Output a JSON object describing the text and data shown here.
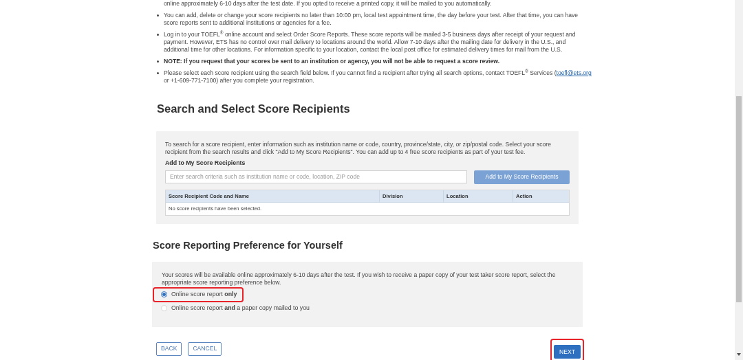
{
  "info_list": [
    {
      "kind": "continuation",
      "text": "online approximately 6-10 days after the test date. If you opted to receive a printed copy, it will be mailed to you automatically."
    },
    {
      "kind": "text",
      "text": "You can add, delete or change your score recipients no later than 10:00 pm, local test appointment time, the day before your test. After that time, you can have score reports sent to additional institutions or agencies for a fee."
    },
    {
      "kind": "text",
      "text": "Log in to your TOEFL$^{®}$ online account and select Order Score Reports. These score reports will be mailed 3-5 business days after receipt of your request and payment. However, ETS has no control over mail delivery to locations around the world. Allow 7-10 days after the mailing date for delivery in the U.S., and additional time for other locations. For information specific to your location, contact the local post office for estimated delivery times for mail from the U.S."
    },
    {
      "kind": "note",
      "text": "NOTE: If you request that your scores be sent to an institution or agency, you will not be able to request a score review."
    },
    {
      "kind": "link_text",
      "before": "Please select each score recipient using the search field below. If you cannot find a recipient after trying all search options, contact TOEFL$^{®}$ Services (",
      "link": "toefl@ets.org",
      "after": " or +1-609-771-7100) after you complete your registration."
    }
  ],
  "recipients": {
    "heading": "Search and Select Score Recipients",
    "intro": "To search for a score recipient, enter information such as institution name or code, country, province/state, city, or zip/postal code. Select your score recipient from the search results and click \"Add to My Score Recipients\". You can add up to 4 free score recipients as part of your test fee.",
    "field_label": "Add to My Score Recipients",
    "search": {
      "placeholder": "Enter search criteria such as institution name or code, location, ZIP code"
    },
    "add_button": "Add to My Score Recipients",
    "table": {
      "columns": [
        "Score Recipient Code and Name",
        "Division",
        "Location",
        "Action"
      ],
      "empty_message": "No score recipients have been selected."
    }
  },
  "preference": {
    "heading": "Score Reporting Preference for Yourself",
    "intro": "Your scores will be available online approximately 6-10 days after the test. If you wish to receive a paper copy of your test taker score report, select the appropriate score reporting preference below.",
    "options": [
      {
        "label": "Online score report **only**",
        "selected": true,
        "highlighted": true
      },
      {
        "label": "Online score report **and** a paper copy mailed to you",
        "selected": false,
        "highlighted": false
      }
    ]
  },
  "buttons": [
    {
      "label": "BACK",
      "kind": "outline",
      "highlighted": false
    },
    {
      "label": "CANCEL",
      "kind": "outline",
      "highlighted": false
    },
    {
      "label": "NEXT",
      "kind": "primary",
      "highlighted": true
    }
  ]
}
